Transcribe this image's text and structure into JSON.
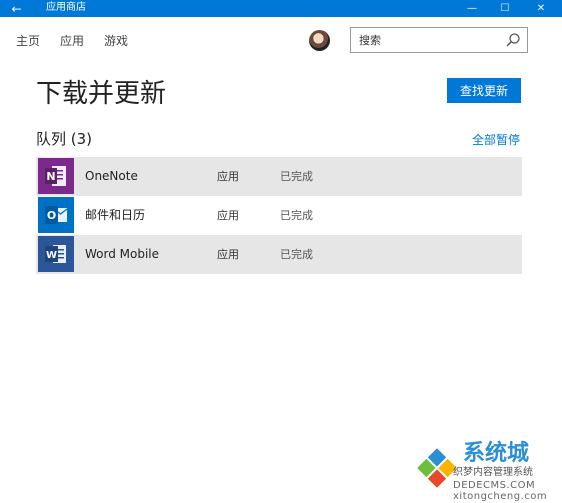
{
  "window": {
    "title": "应用商店",
    "back_icon": "←",
    "minimize_icon": "—",
    "maximize_icon": "☐",
    "close_icon": "✕",
    "accent": "#0078d7"
  },
  "nav": {
    "items": [
      {
        "label": "主页"
      },
      {
        "label": "应用"
      },
      {
        "label": "游戏"
      }
    ]
  },
  "search": {
    "placeholder": "搜索"
  },
  "page": {
    "title": "下载并更新",
    "check_updates": "查找更新"
  },
  "queue": {
    "heading": "队列 (3)",
    "pause_all": "全部暂停",
    "items": [
      {
        "name": "OneNote",
        "type": "应用",
        "status": "已完成",
        "icon": "onenote-icon",
        "icon_color": "#7b2a8c",
        "icon_letter": "N"
      },
      {
        "name": "邮件和日历",
        "type": "应用",
        "status": "已完成",
        "icon": "outlook-icon",
        "icon_color": "#0072c6",
        "icon_letter": "O"
      },
      {
        "name": "Word Mobile",
        "type": "应用",
        "status": "已完成",
        "icon": "word-icon",
        "icon_color": "#2b579a",
        "icon_letter": "W"
      }
    ]
  },
  "watermark": {
    "brand": "系统城",
    "subtitle": "织梦内容管理系统",
    "domain": "DEDECMS.COM",
    "site": "xitongcheng.com"
  }
}
